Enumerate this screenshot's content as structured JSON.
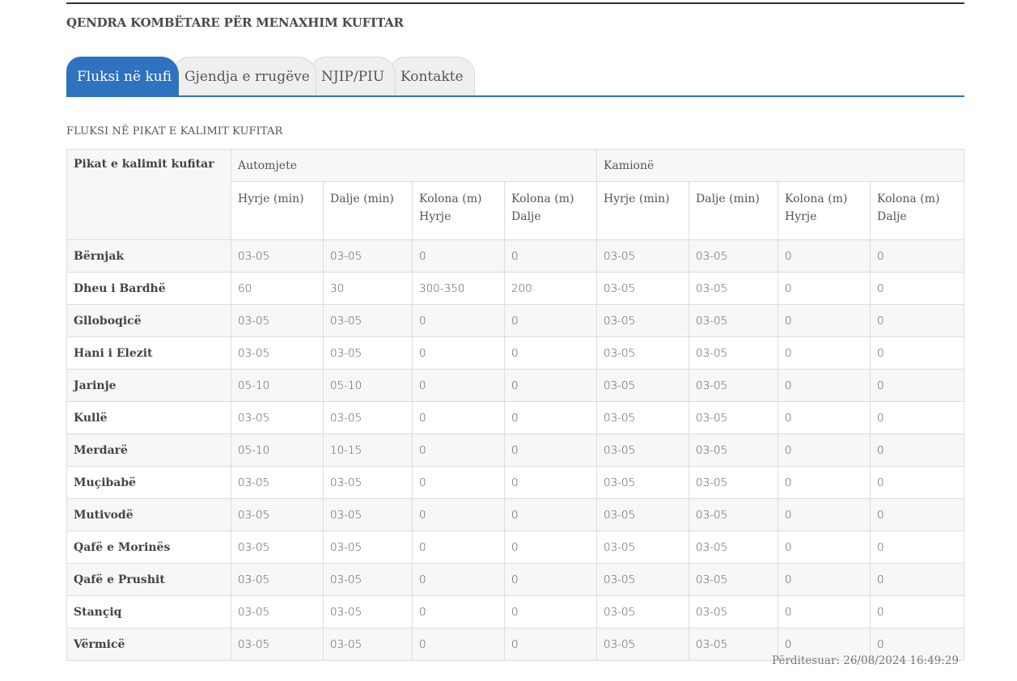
{
  "header": {
    "title": "QENDRA KOMBËTARE PËR MENAXHIM KUFITAR"
  },
  "tabs": [
    {
      "label": "Fluksi në kufi",
      "active": true
    },
    {
      "label": "Gjendja e rrugëve",
      "active": false
    },
    {
      "label": "NJIP/PIU",
      "active": false
    },
    {
      "label": "Kontakte",
      "active": false
    }
  ],
  "section": {
    "title": "FLUKSI NË PIKAT E KALIMIT KUFITAR"
  },
  "table": {
    "row_header": "Pikat e kalimit kufitar",
    "groups": [
      "Automjete",
      "Kamionë"
    ],
    "columns": [
      "Hyrje (min)",
      "Dalje (min)",
      "Kolona (m) Hyrje",
      "Kolona (m) Dalje",
      "Hyrje (min)",
      "Dalje (min)",
      "Kolona (m) Hyrje",
      "Kolona (m) Dalje"
    ],
    "rows": [
      {
        "name": "Bërnjak",
        "values": [
          "03-05",
          "03-05",
          "0",
          "0",
          "03-05",
          "03-05",
          "0",
          "0"
        ]
      },
      {
        "name": "Dheu i Bardhë",
        "values": [
          "60",
          "30",
          "300-350",
          "200",
          "03-05",
          "03-05",
          "0",
          "0"
        ]
      },
      {
        "name": "Glloboqicë",
        "values": [
          "03-05",
          "03-05",
          "0",
          "0",
          "03-05",
          "03-05",
          "0",
          "0"
        ]
      },
      {
        "name": "Hani i Elezit",
        "values": [
          "03-05",
          "03-05",
          "0",
          "0",
          "03-05",
          "03-05",
          "0",
          "0"
        ]
      },
      {
        "name": "Jarinje",
        "values": [
          "05-10",
          "05-10",
          "0",
          "0",
          "03-05",
          "03-05",
          "0",
          "0"
        ]
      },
      {
        "name": "Kullë",
        "values": [
          "03-05",
          "03-05",
          "0",
          "0",
          "03-05",
          "03-05",
          "0",
          "0"
        ]
      },
      {
        "name": "Merdarë",
        "values": [
          "05-10",
          "10-15",
          "0",
          "0",
          "03-05",
          "03-05",
          "0",
          "0"
        ]
      },
      {
        "name": "Muçibabë",
        "values": [
          "03-05",
          "03-05",
          "0",
          "0",
          "03-05",
          "03-05",
          "0",
          "0"
        ]
      },
      {
        "name": "Mutivodë",
        "values": [
          "03-05",
          "03-05",
          "0",
          "0",
          "03-05",
          "03-05",
          "0",
          "0"
        ]
      },
      {
        "name": "Qafë e Morinës",
        "values": [
          "03-05",
          "03-05",
          "0",
          "0",
          "03-05",
          "03-05",
          "0",
          "0"
        ]
      },
      {
        "name": "Qafë e Prushit",
        "values": [
          "03-05",
          "03-05",
          "0",
          "0",
          "03-05",
          "03-05",
          "0",
          "0"
        ]
      },
      {
        "name": "Stançiq",
        "values": [
          "03-05",
          "03-05",
          "0",
          "0",
          "03-05",
          "03-05",
          "0",
          "0"
        ]
      },
      {
        "name": "Vërmicë",
        "values": [
          "03-05",
          "03-05",
          "0",
          "0",
          "03-05",
          "03-05",
          "0",
          "0"
        ]
      }
    ]
  },
  "footer": {
    "updated": "Përditesuar: 26/08/2024 16:49:29"
  },
  "colors": {
    "accent": "#2e72c0",
    "stripe": "#f7f7f7",
    "border": "#dddddd"
  }
}
